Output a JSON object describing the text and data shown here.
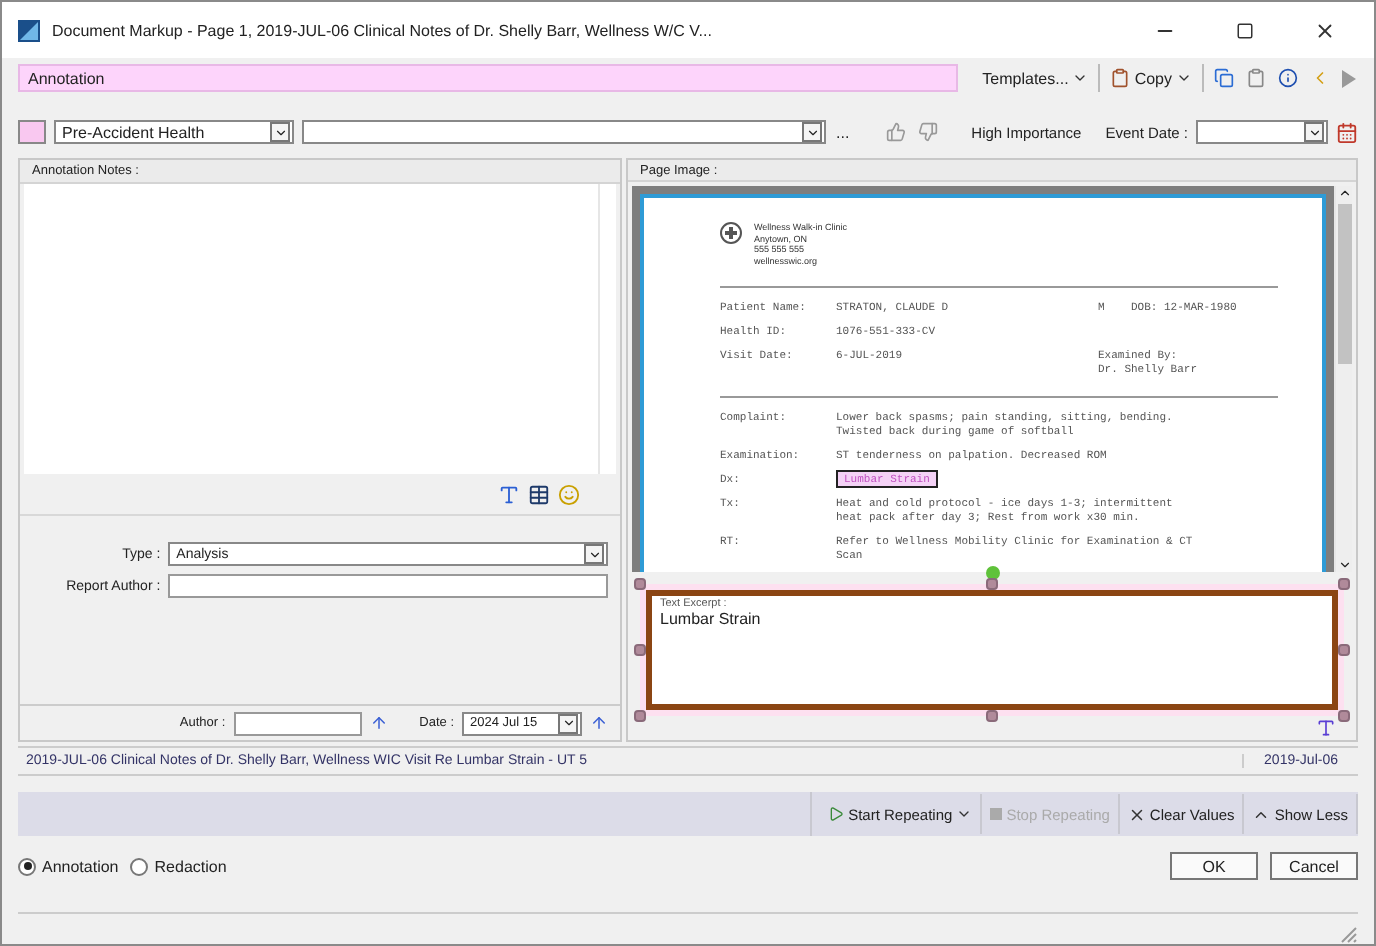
{
  "window": {
    "title": "Document Markup - Page 1, 2019-JUL-06 Clinical Notes of Dr. Shelly Barr, Wellness W/C V..."
  },
  "annotation_bar": {
    "title": "Annotation",
    "templates_button": "Templates...",
    "copy_button": "Copy"
  },
  "toolbar": {
    "category": "Pre-Accident Health",
    "more": "...",
    "importance": "High Importance",
    "event_date_label": "Event Date :"
  },
  "notes_panel": {
    "heading": "Annotation Notes :",
    "type_label": "Type :",
    "type_value": "Analysis",
    "report_author_label": "Report Author :",
    "author_label": "Author :",
    "date_label": "Date :",
    "date_value": "2024 Jul 15"
  },
  "page_panel": {
    "heading": "Page Image :",
    "document": {
      "clinic": [
        "Wellness Walk-in Clinic",
        "Anytown, ON",
        "555 555 555",
        "wellnesswic.org"
      ],
      "patient_rows": [
        {
          "label": "Patient Name:",
          "value": "STRATON, CLAUDE D",
          "aside": [
            "M    DOB: 12-MAR-1980"
          ]
        },
        {
          "label": "Health ID:",
          "value": "1076-551-333-CV",
          "aside": []
        },
        {
          "label": "Visit Date:",
          "value": "6-JUL-2019",
          "aside": [
            "Examined By:",
            "Dr. Shelly Barr"
          ]
        }
      ],
      "clinical_rows": [
        {
          "label": "Complaint:",
          "lines": [
            "Lower back spasms; pain standing, sitting, bending.",
            "Twisted back during game of softball"
          ],
          "highlighted": false
        },
        {
          "label": "Examination:",
          "lines": [
            "ST tenderness on palpation. Decreased ROM"
          ],
          "highlighted": false
        },
        {
          "label": "Dx:",
          "lines": [
            "Lumbar Strain"
          ],
          "highlighted": true
        },
        {
          "label": "Tx:",
          "lines": [
            "Heat and cold protocol - ice days 1-3; intermittent",
            "heat pack after day 3; Rest from work x30 min."
          ],
          "highlighted": false
        },
        {
          "label": "RT:",
          "lines": [
            "Refer to Wellness Mobility Clinic for Examination & CT",
            "Scan"
          ],
          "highlighted": false
        }
      ]
    },
    "excerpt": {
      "label": "Text Excerpt :",
      "text": "Lumbar Strain"
    }
  },
  "status_bar": {
    "description": "2019-JUL-06 Clinical Notes of Dr. Shelly Barr, Wellness WIC Visit Re Lumbar Strain - UT 5",
    "date": "2019-Jul-06"
  },
  "actions": [
    {
      "label": "Start Repeating",
      "kind": "play",
      "disabled": false
    },
    {
      "label": "Stop Repeating",
      "kind": "stop",
      "disabled": true
    },
    {
      "label": "Clear Values",
      "kind": "clear",
      "disabled": false
    },
    {
      "label": "Show Less",
      "kind": "collapse",
      "disabled": false
    }
  ],
  "mode": [
    {
      "label": "Annotation",
      "selected": true
    },
    {
      "label": "Redaction",
      "selected": false
    }
  ],
  "buttons": [
    {
      "label": "OK"
    },
    {
      "label": "Cancel"
    }
  ]
}
